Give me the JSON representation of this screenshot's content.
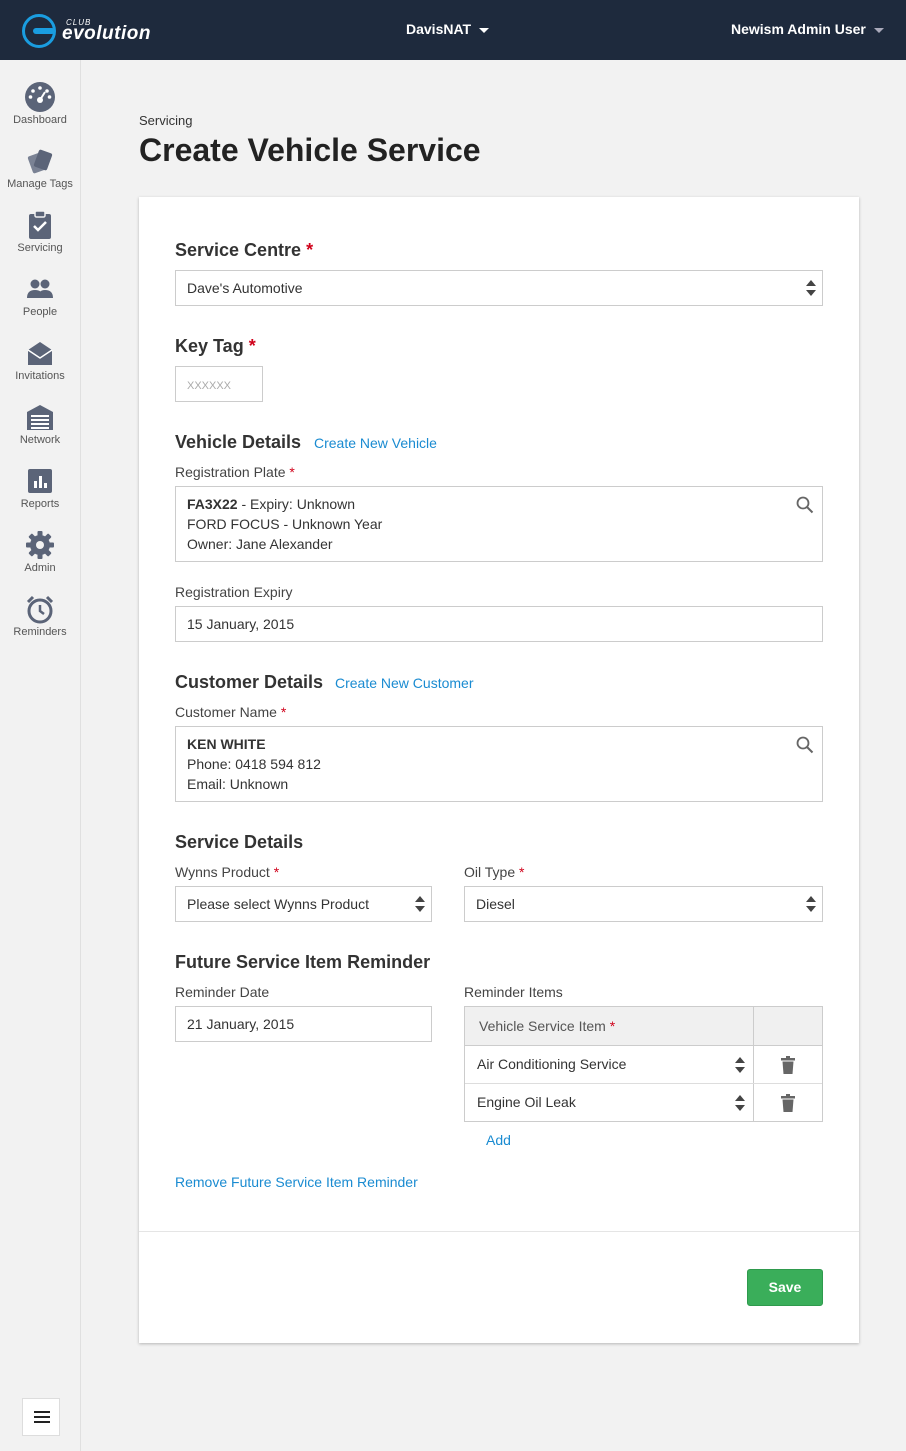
{
  "app": {
    "logo_top": "CLUB",
    "logo_text": "evolution"
  },
  "header": {
    "org": "DavisNAT",
    "user": "Newism Admin User"
  },
  "sidebar": {
    "items": [
      {
        "label": "Dashboard",
        "icon": "dashboard-gauge-icon"
      },
      {
        "label": "Manage Tags",
        "icon": "tags-icon"
      },
      {
        "label": "Servicing",
        "icon": "clipboard-check-icon"
      },
      {
        "label": "People",
        "icon": "people-icon"
      },
      {
        "label": "Invitations",
        "icon": "envelope-icon"
      },
      {
        "label": "Network",
        "icon": "garage-icon"
      },
      {
        "label": "Reports",
        "icon": "bar-chart-icon"
      },
      {
        "label": "Admin",
        "icon": "gear-icon"
      },
      {
        "label": "Reminders",
        "icon": "alarm-clock-icon"
      }
    ]
  },
  "page": {
    "breadcrumb": "Servicing",
    "title": "Create Vehicle Service"
  },
  "form": {
    "service_centre": {
      "label": "Service Centre",
      "value": "Dave's Automotive"
    },
    "key_tag": {
      "label": "Key Tag",
      "placeholder": "XXXXXX"
    },
    "vehicle": {
      "title": "Vehicle Details",
      "create_link": "Create New Vehicle",
      "plate_label": "Registration Plate",
      "plate_bold": "FA3X22",
      "plate_rest": " - Expiry: Unknown",
      "line2": "FORD FOCUS - Unknown Year",
      "line3": "Owner: Jane Alexander",
      "expiry_label": "Registration Expiry",
      "expiry_value": "15 January, 2015"
    },
    "customer": {
      "title": "Customer Details",
      "create_link": "Create New Customer",
      "name_label": "Customer Name",
      "name": "KEN WHITE",
      "phone": "Phone: 0418 594 812",
      "email": "Email: Unknown"
    },
    "service": {
      "title": "Service Details",
      "product_label": "Wynns Product",
      "product_value": "Please select Wynns Product",
      "oil_label": "Oil Type",
      "oil_value": "Diesel"
    },
    "reminder": {
      "title": "Future Service Item Reminder",
      "date_label": "Reminder Date",
      "date_value": "21 January, 2015",
      "items_label": "Reminder Items",
      "column_header": "Vehicle Service Item",
      "items": [
        "Air Conditioning Service",
        "Engine Oil Leak"
      ],
      "add_link": "Add",
      "remove_link": "Remove Future Service Item Reminder"
    },
    "required_mark": "*",
    "save_label": "Save"
  }
}
